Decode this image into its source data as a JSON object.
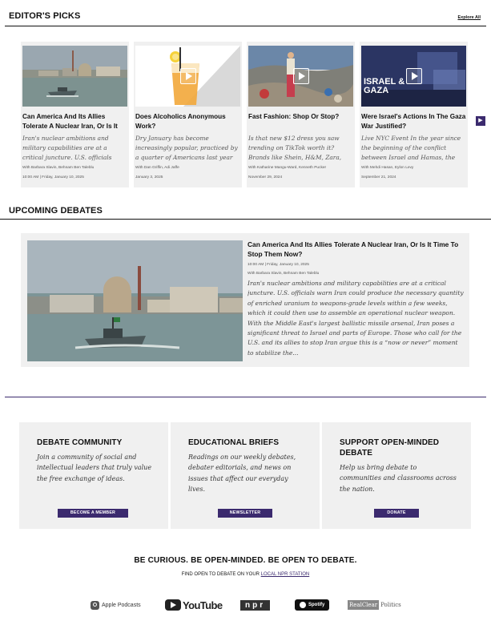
{
  "editors_picks": {
    "title": "EDITOR'S PICKS",
    "explore_label": "Explore All",
    "cards": [
      {
        "title": "Can America And Its Allies Tolerate A Nuclear Iran, Or Is It Time To Stop Them Now?",
        "desc": "Iran's nuclear ambitions and military capabilities are at a critical juncture. U.S. officials warn Iran could produce the necessary quantity",
        "with": "With Barbara Slavin, Behnam Ben Taleblu",
        "date": "10:00 AM | Friday, January 10, 2025"
      },
      {
        "title": "Does Alcoholics Anonymous Work?",
        "desc": "Dry January has become increasingly popular, practiced by a quarter of Americans last year",
        "with": "With Dan Griffin, Adi Jaffe",
        "date": "January 3, 2025"
      },
      {
        "title": "Fast Fashion: Shop Or Stop?",
        "desc": "Is that new $12 dress you saw trending on TikTok worth it? Brands like Shein, H&M, Zara, and more",
        "with": "With Katharine Mangu-Ward, Kenneth Pucker",
        "date": "November 29, 2024"
      },
      {
        "title": "Were Israel's Actions In The Gaza War Justified?",
        "desc": "Live NYC Event In the year since the beginning of the conflict between Israel and Hamas, the",
        "with": "With Mehdi Hasan, Eylon Levy",
        "date": "September 21, 2024",
        "overlay_text": "ISRAEL & GAZA"
      }
    ]
  },
  "upcoming": {
    "title": "UPCOMING DEBATES",
    "debate": {
      "title": "Can America And Its Allies Tolerate A Nuclear Iran, Or Is It Time To Stop Them Now?",
      "date": "10:00 AM | Friday, January 10, 2025",
      "with": "With Barbara Slavin, Behnam Ben Taleblu",
      "desc": "Iran's nuclear ambitions and military capabilities are at a critical juncture. U.S. officials warn Iran could produce the necessary quantity of enriched uranium to weapons-grade levels within a few weeks, which it could then use to assemble an operational nuclear weapon. With the Middle East's largest ballistic missile arsenal, Iran poses a significant threat to Israel and parts of Europe. Those who call for the U.S. and its allies to stop Iran argue this is a “now or never” moment to stabilize the..."
    }
  },
  "info_boxes": [
    {
      "heading": "DEBATE COMMUNITY",
      "body": "Join a community of social and intellectual leaders that truly value the free exchange of ideas.",
      "button": "BECOME A MEMBER"
    },
    {
      "heading": "EDUCATIONAL BRIEFS",
      "body": "Readings on our weekly debates, debater editorials, and news on issues that affect our everyday lives.",
      "button": "NEWSLETTER"
    },
    {
      "heading": "SUPPORT OPEN-MINDED DEBATE",
      "body": "Help us bring debate to communities and classrooms across the nation.",
      "button": "DONATE"
    }
  ],
  "footer": {
    "motto": "BE CURIOUS. BE OPEN-MINDED. BE OPEN TO DEBATE.",
    "find_text": "FIND OPEN TO DEBATE ON YOUR ",
    "find_link": "LOCAL NPR STATION",
    "logos": {
      "apple": "Apple Podcasts",
      "youtube": "YouTube",
      "npr": "npr",
      "spotify": "Spotify",
      "rcp_a": "RealClear",
      "rcp_b": "Politics"
    }
  },
  "colors": {
    "accent": "#3b2a6e",
    "card_bg": "#f0f0f0"
  }
}
